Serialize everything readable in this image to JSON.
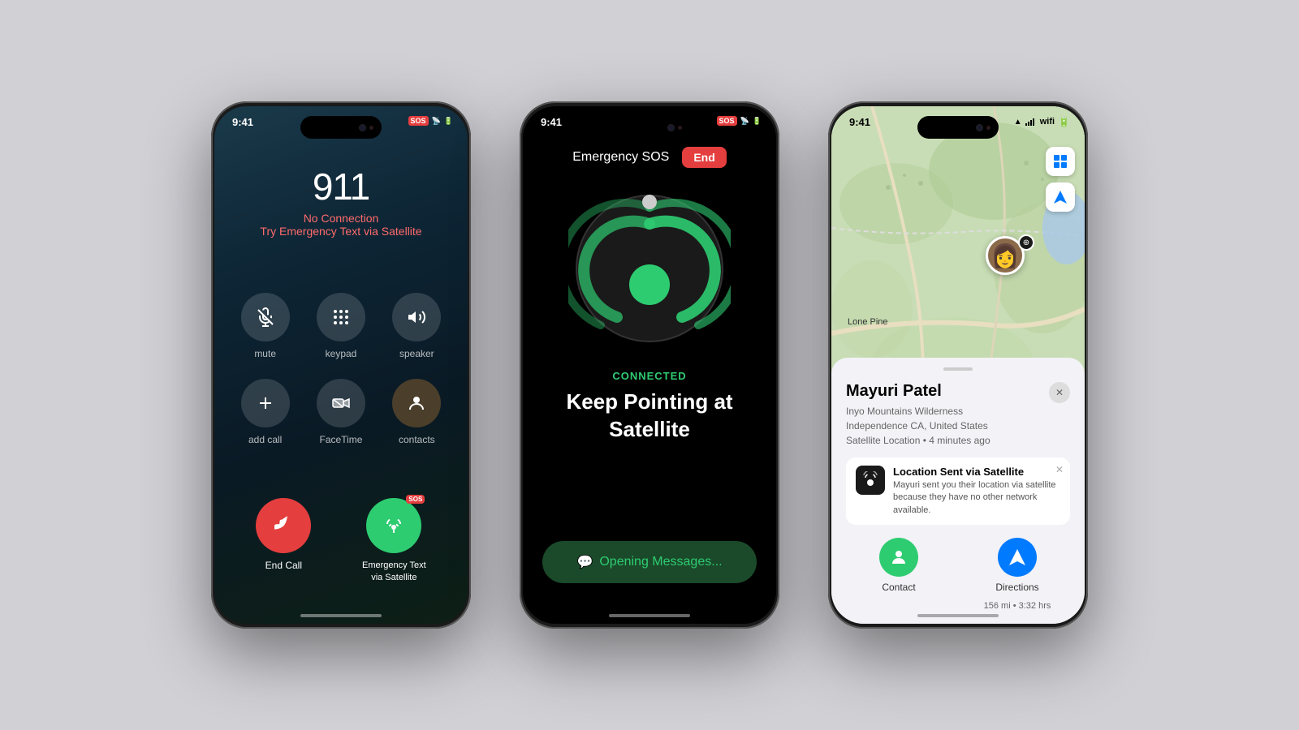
{
  "page": {
    "background": "#d0d0d5"
  },
  "phone1": {
    "status_time": "9:41",
    "sos_label": "SOS",
    "call_number": "911",
    "no_connection": "No Connection",
    "satellite_prompt": "Try Emergency Text via Satellite",
    "controls": [
      {
        "id": "mute",
        "label": "mute",
        "icon": "🎙️"
      },
      {
        "id": "keypad",
        "label": "keypad",
        "icon": "⌨️"
      },
      {
        "id": "speaker",
        "label": "speaker",
        "icon": "🔊"
      },
      {
        "id": "add_call",
        "label": "add call",
        "icon": "+"
      },
      {
        "id": "facetime",
        "label": "FaceTime",
        "icon": "📹"
      },
      {
        "id": "contacts",
        "label": "contacts",
        "icon": "👤"
      }
    ],
    "end_call_label": "End Call",
    "sos_satellite_label": "Emergency Text\nvia Satellite",
    "sos_tag": "SOS"
  },
  "phone2": {
    "status_time": "9:41",
    "title": "Emergency SOS",
    "end_btn": "End",
    "connected_label": "CONNECTED",
    "keep_pointing": "Keep Pointing at\nSatellite",
    "opening_messages": "Opening Messages..."
  },
  "phone3": {
    "status_time": "9:41",
    "person_name": "Mayuri Patel",
    "location_line1": "Inyo Mountains Wilderness",
    "location_line2": "Independence CA, United States",
    "location_line3": "Satellite Location • 4 minutes ago",
    "lone_pine": "Lone Pine",
    "notif_title": "Location Sent via Satellite",
    "notif_body": "Mayuri sent you their location via satellite because they have no other network available.",
    "action1_label": "Contact",
    "action2_label": "Directions",
    "distance": "156 mi • 3:32 hrs"
  }
}
